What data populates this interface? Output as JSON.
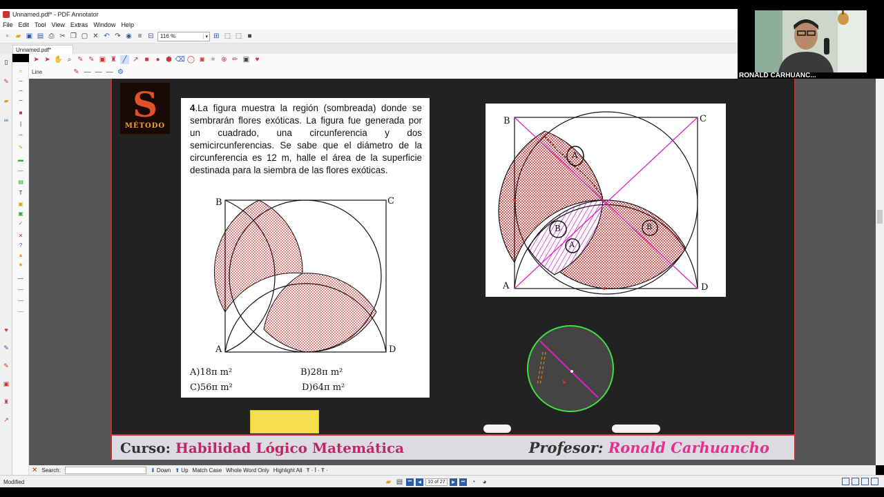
{
  "window": {
    "title": "Unnamed.pdf* - PDF Annotator",
    "tab": "Unnamed.pdf*"
  },
  "menu": [
    "File",
    "Edit",
    "Tool",
    "View",
    "Extras",
    "Window",
    "Help"
  ],
  "toolbar": {
    "zoom": "116 %",
    "tool_name": "Line"
  },
  "logo": {
    "letter": "S",
    "caption": "MÉTODO"
  },
  "problem": {
    "number": "4",
    "statement": ".La figura muestra la región (sombreada) donde se sembrarán flores exóticas. La figura fue generada por un cuadrado, una circunferencia y dos semicircunferencias. Se sabe que el diámetro de la circunferencia es 12 m, halle el área de la superficie destinada para la siembra de las flores exóticas.",
    "points": {
      "a": "A",
      "b": "B",
      "c": "C",
      "d": "D"
    },
    "options": [
      {
        "letter": "A)",
        "value": "18π m²"
      },
      {
        "letter": "B)",
        "value": "28π m²"
      },
      {
        "letter": "C)",
        "value": "56π m²"
      },
      {
        "letter": "D)",
        "value": "64π m²"
      }
    ]
  },
  "solution": {
    "points": {
      "a": "A",
      "b": "B",
      "c": "C",
      "d": "D"
    },
    "annotations": [
      "A",
      "B",
      "A",
      "B"
    ]
  },
  "footer": {
    "course_label": "Curso:",
    "course_name": "Habilidad Lógico Matemática",
    "professor_label": "Profesor:",
    "professor_name": "Ronald Carhuancho"
  },
  "search": {
    "label": "Search:",
    "down": "Down",
    "up": "Up",
    "match_case": "Match Case",
    "whole_word": "Whole Word Only",
    "highlight_all": "Highlight All"
  },
  "status": {
    "text": "Modified",
    "page": "10 of 27"
  },
  "webcam": {
    "name": "RONALD CARHUANC..."
  },
  "colors": {
    "accent": "#c0246a",
    "board": "#222222",
    "border": "#bb3333",
    "shade": "#d42020"
  }
}
